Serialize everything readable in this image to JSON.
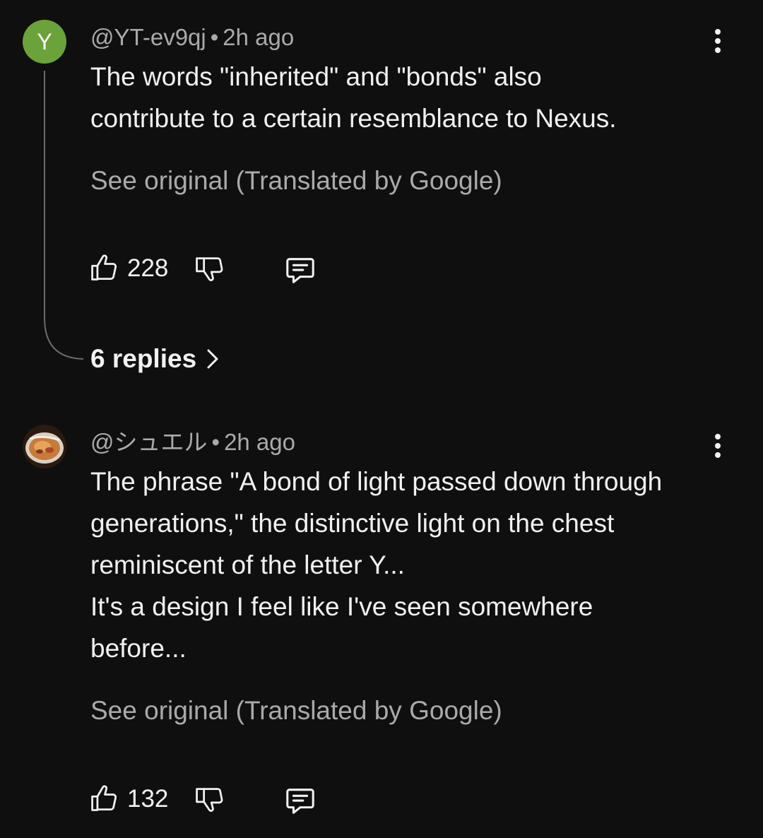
{
  "comments": [
    {
      "avatar": {
        "letter": "Y",
        "color": "#6aa33a"
      },
      "author": "@YT-ev9qj",
      "separator": "•",
      "time": "2h ago",
      "text": "The words \"inherited\" and \"bonds\" also\ncontribute to a certain resemblance to Nexus.",
      "see_original": "See original (Translated by Google)",
      "likes": "228",
      "replies_label": "6 replies"
    },
    {
      "avatar": {
        "icon": "food-bowl-photo"
      },
      "author": "@シュエル",
      "separator": "•",
      "time": "2h ago",
      "text": "The phrase \"A bond of light passed down through\ngenerations,\" the distinctive light on the chest\nreminiscent of the letter Y...\nIt's a design I feel like I've seen somewhere\nbefore...",
      "see_original": "See original (Translated by Google)",
      "likes": "132"
    }
  ],
  "icons": {
    "like": "thumb-up-icon",
    "dislike": "thumb-down-icon",
    "reply": "comment-icon",
    "more": "more-vert-icon",
    "chevron": "chevron-right-icon"
  },
  "colors": {
    "background": "#0f0f0f",
    "text_primary": "#f1f1f1",
    "text_secondary": "#aaaaaa",
    "avatar_green": "#6aa33a"
  }
}
